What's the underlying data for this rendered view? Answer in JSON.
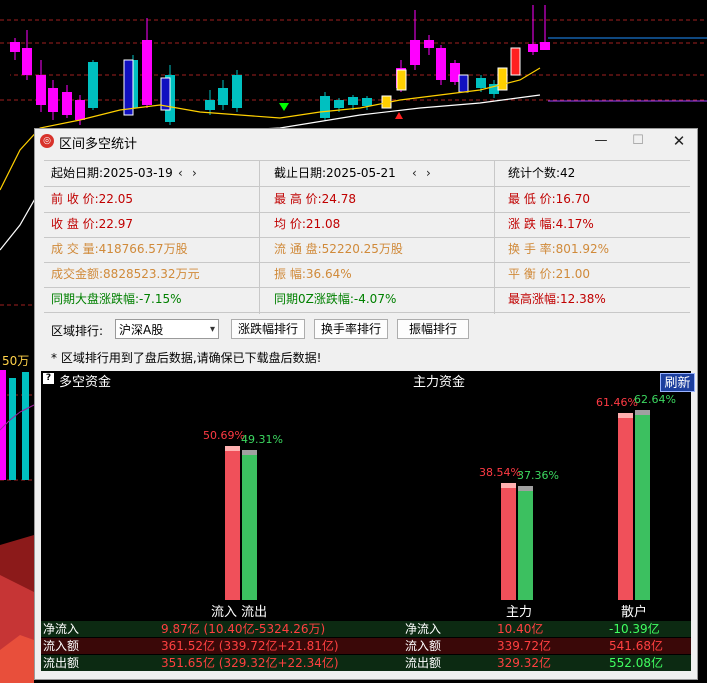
{
  "background": {
    "volume_label": "50万",
    "up_color": "#ff00ff",
    "down_color": "#00c0c0",
    "signal_color": "#00ff00"
  },
  "dialog": {
    "title": "区间多空统计",
    "min_label": "—",
    "max_label": "☐",
    "close_label": "✕"
  },
  "stats": {
    "start_label": "起始日期:2025-03-19",
    "end_label": "截止日期:2025-05-21",
    "count_label": "统计个数:42",
    "prev_arrow": "‹",
    "next_arrow": "›",
    "rows": [
      [
        {
          "text": "前 收 价:22.05",
          "color": "red"
        },
        {
          "text": "最 高 价:24.78",
          "color": "red"
        },
        {
          "text": "最 低 价:16.70",
          "color": "red"
        }
      ],
      [
        {
          "text": "收 盘 价:22.97",
          "color": "red"
        },
        {
          "text": "均    价:21.08",
          "color": "red"
        },
        {
          "text": "涨 跌 幅:4.17%",
          "color": "red"
        }
      ],
      [
        {
          "text": "成 交 量:418766.57万股",
          "color": "orange"
        },
        {
          "text": "流 通 盘:52220.25万股",
          "color": "orange"
        },
        {
          "text": "换 手 率:801.92%",
          "color": "orange"
        }
      ],
      [
        {
          "text": "成交金额:8828523.32万元",
          "color": "orange"
        },
        {
          "text": "振    幅:36.64%",
          "color": "orange"
        },
        {
          "text": "平 衡 价:21.00",
          "color": "orange"
        }
      ],
      [
        {
          "text": "同期大盘涨跌幅:-7.15%",
          "color": "green"
        },
        {
          "text": "同期0Z涨跌幅:-4.07%",
          "color": "green"
        },
        {
          "text": "最高涨幅:12.38%",
          "color": "red"
        }
      ]
    ]
  },
  "toolbar": {
    "label": "区域排行:",
    "select_value": "沪深A股",
    "btn_change": "涨跌幅排行",
    "btn_turnover": "换手率排行",
    "btn_amplitude": "振幅排行"
  },
  "note": "* 区域排行用到了盘后数据,请确保已下载盘后数据!",
  "panel": {
    "left_title": "多空资金",
    "right_title": "主力资金",
    "refresh_label": "刷新",
    "help_icon": "?",
    "colors": {
      "inflow": "#f0505a",
      "outflow": "#3cc060"
    },
    "groups": [
      {
        "label": "流入 流出",
        "inflow_pct": "50.69%",
        "outflow_pct": "49.31%",
        "inflow": 50.69,
        "outflow": 49.31
      },
      {
        "label": "主力",
        "inflow_pct": "38.54%",
        "outflow_pct": "37.36%",
        "inflow": 38.54,
        "outflow": 37.36
      },
      {
        "label": "散户",
        "inflow_pct": "61.46%",
        "outflow_pct": "62.64%",
        "inflow": 61.46,
        "outflow": 62.64
      }
    ],
    "table": [
      {
        "key": "净流入",
        "left": "9.87亿 (10.40亿-5324.26万)",
        "key2": "净流入",
        "main": "10.40亿",
        "retail": "-10.39亿"
      },
      {
        "key": "流入额",
        "left": "361.52亿 (339.72亿+21.81亿)",
        "key2": "流入额",
        "main": "339.72亿",
        "retail": "541.68亿"
      },
      {
        "key": "流出额",
        "left": "351.65亿 (329.32亿+22.34亿)",
        "key2": "流出额",
        "main": "329.32亿",
        "retail": "552.08亿"
      }
    ]
  }
}
